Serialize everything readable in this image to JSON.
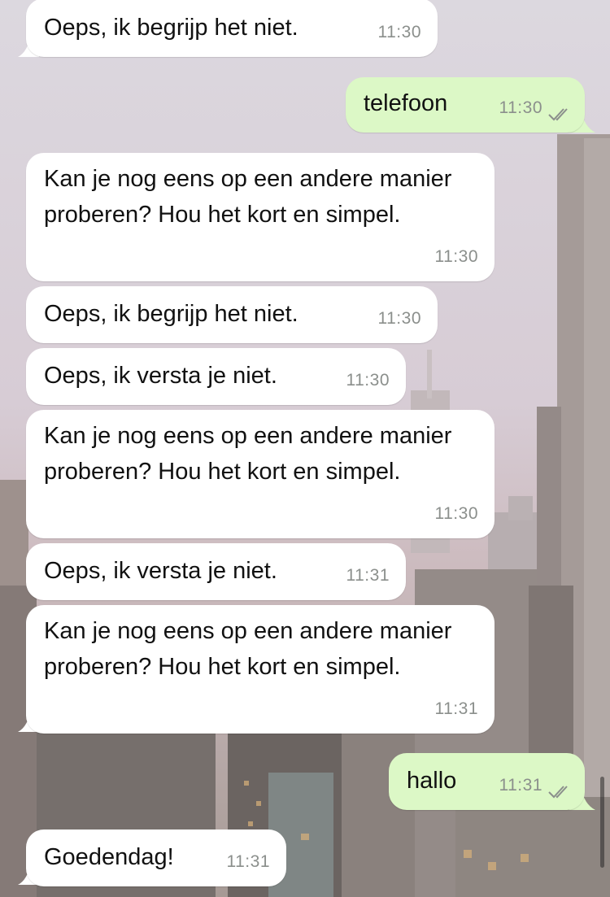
{
  "messages": [
    {
      "direction": "in",
      "text": "Oeps, ik begrijp het niet.",
      "time": "11:30"
    },
    {
      "direction": "out",
      "text": "telefoon",
      "time": "11:30",
      "status": "double-check-read"
    },
    {
      "direction": "in",
      "text": "Kan je nog eens op een andere manier proberen? Hou het kort en simpel.",
      "time": "11:30"
    },
    {
      "direction": "in",
      "text": "Oeps, ik begrijp het niet.",
      "time": "11:30"
    },
    {
      "direction": "in",
      "text": "Oeps, ik versta je niet.",
      "time": "11:30"
    },
    {
      "direction": "in",
      "text": "Kan je nog eens op een andere manier proberen? Hou het kort en simpel.",
      "time": "11:30"
    },
    {
      "direction": "in",
      "text": "Oeps, ik versta je niet.",
      "time": "11:31"
    },
    {
      "direction": "in",
      "text": "Kan je nog eens op een andere manier proberen? Hou het kort en simpel.",
      "time": "11:31"
    },
    {
      "direction": "out",
      "text": "hallo",
      "time": "11:31",
      "status": "double-check-read"
    },
    {
      "direction": "in",
      "text": "Goedendag!",
      "time": "11:31"
    }
  ],
  "colors": {
    "incoming_bubble": "#ffffff",
    "outgoing_bubble": "#dcf8c6",
    "timestamp": "#8b8f8c",
    "wallpaper": "city-skyline-dusk"
  }
}
